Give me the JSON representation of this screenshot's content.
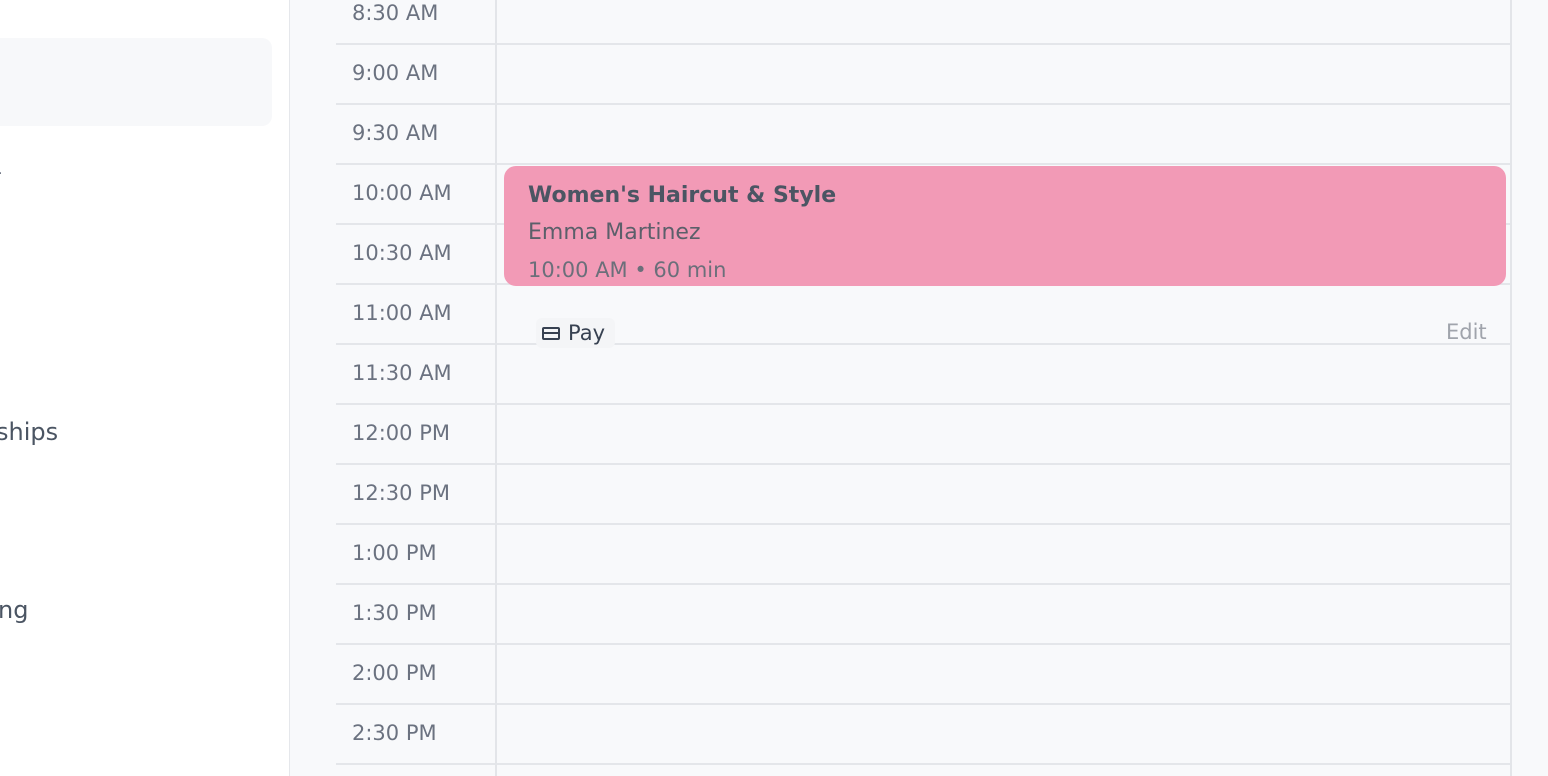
{
  "sidebar": {
    "fragment_top": ".",
    "item_ships": "ships",
    "item_ng": "ng"
  },
  "calendar": {
    "time_slots": [
      "8:30 AM",
      "9:00 AM",
      "9:30 AM",
      "10:00 AM",
      "10:30 AM",
      "11:00 AM",
      "11:30 AM",
      "12:00 PM",
      "12:30 PM",
      "1:00 PM",
      "1:30 PM",
      "2:00 PM",
      "2:30 PM"
    ]
  },
  "appointment": {
    "service": "Women's Haircut & Style",
    "client": "Emma Martinez",
    "time_duration": "10:00 AM • 60 min",
    "color": "#f29ab6",
    "pay_label": "Pay",
    "edit_label": "Edit"
  },
  "icons": {
    "pay": "credit-card-icon"
  }
}
